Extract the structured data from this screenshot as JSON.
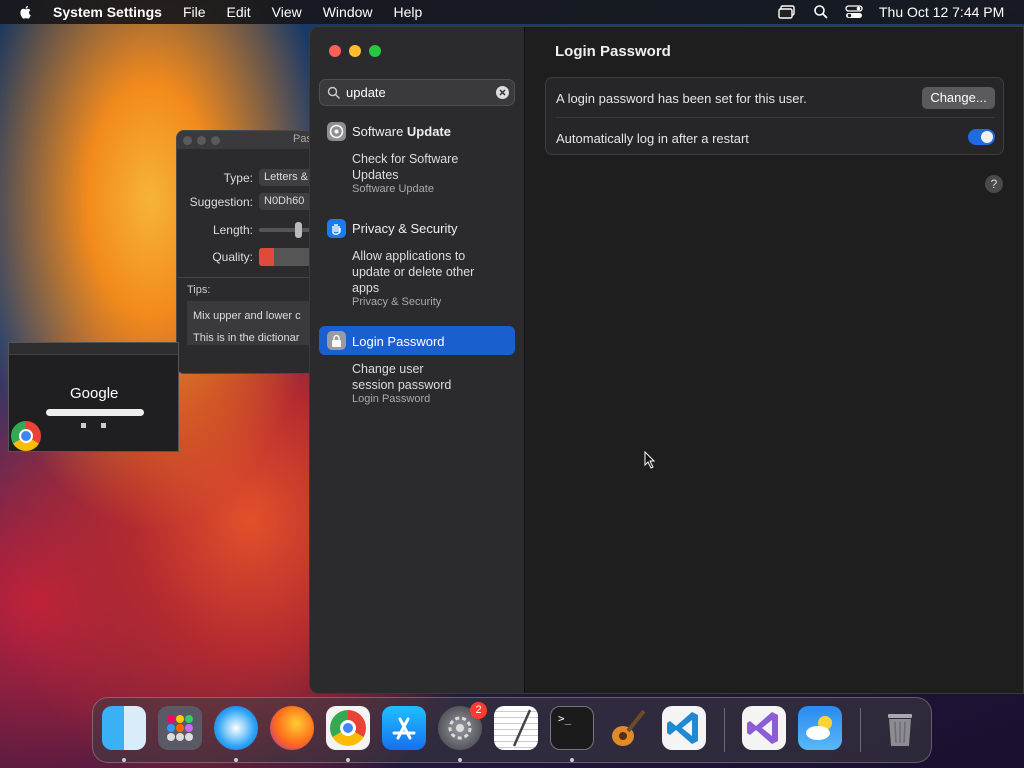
{
  "menubar": {
    "app_name": "System Settings",
    "menus": [
      "File",
      "Edit",
      "View",
      "Window",
      "Help"
    ],
    "datetime": "Thu Oct 12  7:44 PM"
  },
  "password_assistant": {
    "title_fragment": "Pas",
    "type_label": "Type:",
    "type_value": "Letters &",
    "suggestion_label": "Suggestion:",
    "suggestion_value": "N0Dh60",
    "length_label": "Length:",
    "quality_label": "Quality:",
    "tips_label": "Tips:",
    "tips": [
      "Mix upper and lower c",
      "This is in the dictionar"
    ]
  },
  "chrome_thumbnail": {
    "logo_text": "Google"
  },
  "settings": {
    "search": {
      "value": "update"
    },
    "results": [
      {
        "title_plain": "Software ",
        "title_bold": "Update",
        "sub_lines": [
          "Check for Software",
          "Updates"
        ],
        "category": "Software Update"
      },
      {
        "title": "Privacy & Security",
        "sub_lines": [
          "Allow applications to",
          "update or delete other",
          "apps"
        ],
        "category": "Privacy & Security"
      },
      {
        "title": "Login Password",
        "sub_lines": [
          "Change user",
          "session password"
        ],
        "category": "Login Password"
      }
    ],
    "content": {
      "title": "Login Password",
      "row1_text": "A login password has been set for this user.",
      "change_button": "Change...",
      "row2_text": "Automatically log in after a restart",
      "auto_login_enabled": true,
      "help": "?"
    }
  },
  "dock": {
    "badge_count": "2",
    "icons": [
      "finder-icon",
      "launchpad-icon",
      "safari-icon",
      "firefox-icon",
      "chrome-icon",
      "app-store-icon",
      "system-settings-icon",
      "textedit-icon",
      "terminal-icon",
      "garageband-icon",
      "vscode-icon",
      "visual-studio-icon",
      "weather-icon",
      "trash-icon"
    ]
  }
}
